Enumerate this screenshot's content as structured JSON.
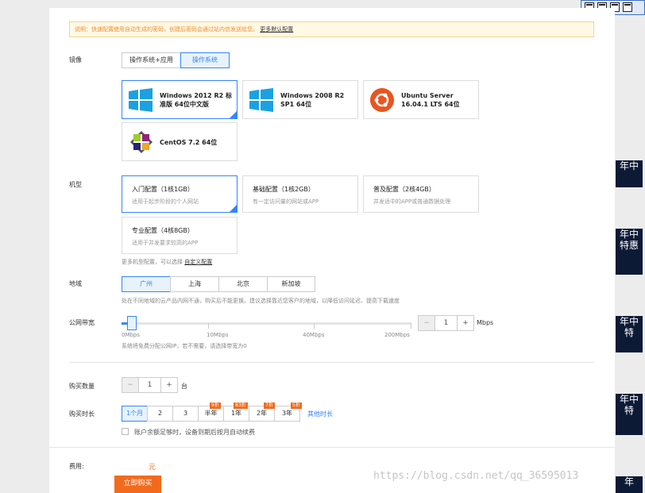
{
  "notice": {
    "text": "说明：快速配置使用自动生成的密码，创建后密码会通过站内信发送给您。",
    "link": "更多默认配置"
  },
  "image": {
    "label": "镜像",
    "tabs": [
      "操作系统+应用",
      "操作系统"
    ],
    "active_tab": 1,
    "options": [
      {
        "title": "Windows 2012 R2 标准版 64位中文版",
        "icon": "windows-logo-icon",
        "selected": true
      },
      {
        "title": "Windows 2008 R2 SP1 64位",
        "icon": "windows-logo-icon",
        "selected": false
      },
      {
        "title": "Ubuntu Server 16.04.1 LTS 64位",
        "icon": "ubuntu-logo-icon",
        "selected": false
      },
      {
        "title": "CentOS 7.2 64位",
        "icon": "centos-logo-icon",
        "selected": false
      }
    ]
  },
  "instance": {
    "label": "机型",
    "options": [
      {
        "title": "入门配置（1核1GB）",
        "desc": "适用于起步阶段的个人网站",
        "selected": true
      },
      {
        "title": "基础配置（1核2GB）",
        "desc": "有一定访问量的网站或APP",
        "selected": false
      },
      {
        "title": "普及配置（2核4GB）",
        "desc": "并发适中的APP或普通数据处理",
        "selected": false
      },
      {
        "title": "专业配置（4核8GB）",
        "desc": "适用于并发要求较高的APP",
        "selected": false
      }
    ],
    "hint": "更多机型配置，可以选择",
    "hint_link": "自定义配置"
  },
  "region": {
    "label": "地域",
    "options": [
      "广州",
      "上海",
      "北京",
      "新加坡"
    ],
    "selected": 0,
    "hint": "处在不同地域的云产品内网不通，购买后不能更换。建议选择靠近您客户的地域，以降低访问延迟、提高下载速度"
  },
  "bandwidth": {
    "label": "公网带宽",
    "value": 1,
    "slider_value_mbps": 1,
    "ticks": [
      "0Mbps",
      "10Mbps",
      "40Mbps",
      "200Mbps"
    ],
    "unit": "Mbps",
    "minus": "−",
    "plus": "+",
    "hint": "系统将免费分配公网IP，若不需要，请选择带宽为0"
  },
  "quantity": {
    "label": "购买数量",
    "value": 1,
    "unit": "台",
    "minus": "−",
    "plus": "+"
  },
  "duration": {
    "label": "购买时长",
    "options": [
      {
        "label": "1个月",
        "tag": ""
      },
      {
        "label": "2",
        "tag": ""
      },
      {
        "label": "3",
        "tag": ""
      },
      {
        "label": "半年",
        "tag": "9折"
      },
      {
        "label": "1年",
        "tag": "83折"
      },
      {
        "label": "2年",
        "tag": "7折"
      },
      {
        "label": "3年",
        "tag": "5折"
      }
    ],
    "selected": 0,
    "more": "其他时长",
    "autorenew": "账户余额足够时，设备到期后按月自动续费",
    "autorenew_checked": false
  },
  "fee": {
    "label": "费用:",
    "amount": "元",
    "buy_button": "立即购买"
  },
  "side_widgets": [
    "年中",
    "年中特惠",
    "年中特",
    "年中特",
    "年"
  ],
  "watermark": "https://blog.csdn.net/qq_36595013",
  "colors": {
    "accent": "#3385ff",
    "orange": "#f26b1d",
    "notice_bg": "#fff9e6"
  }
}
